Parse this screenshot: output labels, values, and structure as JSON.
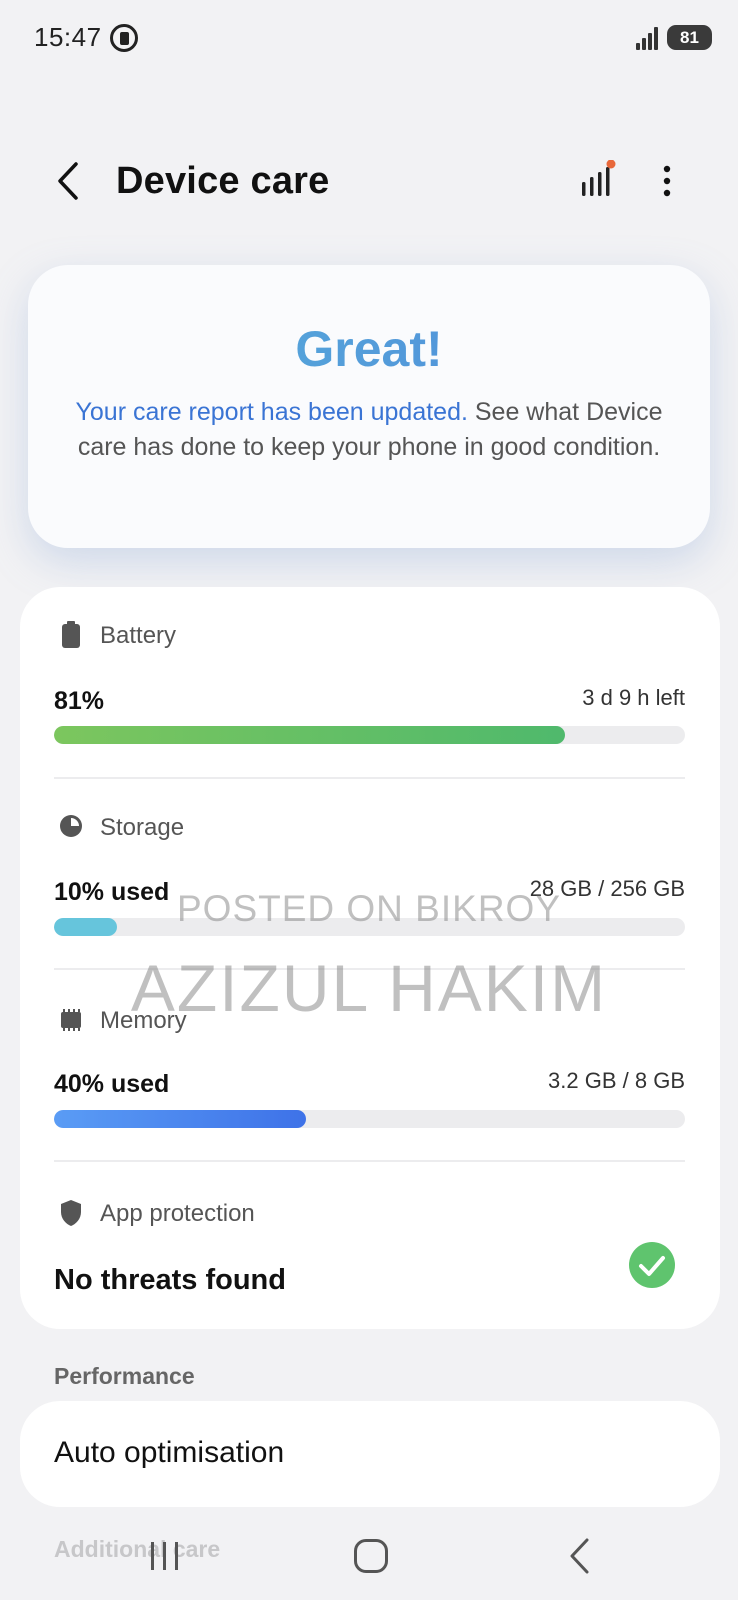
{
  "status_bar": {
    "time": "15:47",
    "battery_level": "81"
  },
  "header": {
    "title": "Device care"
  },
  "hero": {
    "title": "Great!",
    "message_highlight": "Your care report has been updated.",
    "message_rest": " See what Device care has done to keep your phone in good condition."
  },
  "battery": {
    "label": "Battery",
    "value": "81%",
    "detail": "3 d 9 h left",
    "fill_percent": 81
  },
  "storage": {
    "label": "Storage",
    "value": "10% used",
    "detail": "28 GB / 256 GB",
    "fill_percent": 10
  },
  "memory": {
    "label": "Memory",
    "value": "40% used",
    "detail": "3.2 GB / 8 GB",
    "fill_percent": 40
  },
  "app_protection": {
    "label": "App protection",
    "value": "No threats found"
  },
  "performance": {
    "section_label": "Performance",
    "auto_optimisation_label": "Auto optimisation"
  },
  "additional_care": {
    "section_label": "Additional care"
  },
  "watermark": {
    "line1": "POSTED ON BIKROY",
    "line2": "AZIZUL HAKIM"
  },
  "colors": {
    "battery_fill": "#6cc05a",
    "storage_fill": "#66c5dc",
    "memory_fill": "#4a83ee",
    "check_green": "#5fc46e",
    "accent_blue": "#3a74d4"
  },
  "icons": [
    "back-icon",
    "bars-icon",
    "more-icon",
    "battery-icon",
    "storage-icon",
    "memory-icon",
    "shield-icon",
    "check-icon"
  ]
}
